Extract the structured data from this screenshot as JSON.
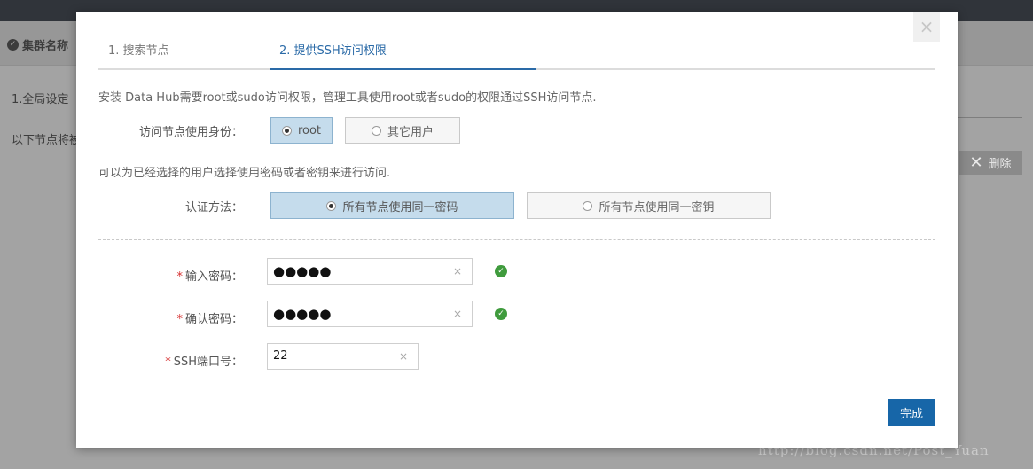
{
  "background": {
    "cluster_label": "集群名称",
    "step_label": "1.全局设定",
    "nodes_text": "以下节点将被",
    "delete_label": "删除",
    "watermark": "http://blog.csdn.net/Post_Yuan"
  },
  "modal": {
    "close_symbol": "×",
    "tabs": [
      {
        "label": "1. 搜索节点"
      },
      {
        "label": "2. 提供SSH访问权限"
      }
    ],
    "description": "安装 Data Hub需要root或sudo访问权限，管理工具使用root或者sudo的权限通过SSH访问节点.",
    "identity": {
      "label": "访问节点使用身份：",
      "options": [
        "root",
        "其它用户"
      ],
      "selected": "root"
    },
    "auth_hint": "可以为已经选择的用户选择使用密码或者密钥来进行访问.",
    "auth": {
      "label": "认证方法：",
      "options": [
        "所有节点使用同一密码",
        "所有节点使用同一密钥"
      ],
      "selected": "所有节点使用同一密码"
    },
    "fields": {
      "password": {
        "label": "输入密码：",
        "value": "●●●●●",
        "clear": "×"
      },
      "confirm": {
        "label": "确认密码：",
        "value": "●●●●●",
        "clear": "×"
      },
      "ssh_port": {
        "label": "SSH端口号：",
        "value": "22",
        "clear": "×"
      }
    },
    "required_mark": "*",
    "finish_label": "完成"
  }
}
